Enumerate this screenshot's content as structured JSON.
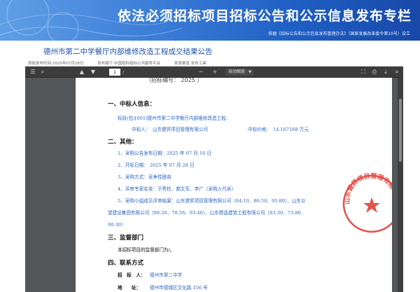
{
  "banner": {
    "title": "依法必须招标项目招标公告和公示信息发布专栏",
    "subtitle": "依据《招标公告和公示信息发布管理办法》（国家发展改革委令第10号）设立"
  },
  "page": {
    "title": "德州市第二中学餐厅内部维修改造工程成交结果公告",
    "meta": [
      "原始发布时间:2025年07月28日",
      "发布媒介:中国招标投标公共服务平台",
      "来源渠道:发布工具"
    ]
  },
  "viewer": {
    "toolbar": {
      "current_page": "1",
      "page_sep": "/",
      "zoom": "自动缩放"
    },
    "top_cut_text": "（招标编号：     2025               ）",
    "sections": {
      "winner_heading": "一、中标人信息：",
      "lot_line": "标段(包)[001]德州市第二中学餐厅内部维修改造工程:",
      "winner_label": "中标人：",
      "winner_name": "山东健昇项目管理有限公司",
      "price_label": "中标价格：",
      "price_value": "14.167168 万元",
      "other_heading": "二、其他：",
      "other_items": [
        "1、采购公告发布日期：2025 年 07 月 16 日",
        "2、开标日期： 2025 年 07 月 28 日",
        "3、采购方式：竞争性磋商",
        "4、评审专家名单：于秀柱、郝文军、李广（采购人代表）",
        "5、采购小组成员评审结果：山东健昇项目管理有限公司（84.10、86.50、95.80）、山东众",
        "望建设集团有限公司（86.26、78.56、93.46）、山东鼎晶建筑工程有限公司（83.30、73.80、",
        "90.30）"
      ],
      "supervise_heading": "三、监督部门",
      "supervise_text": "本招标项目的监督部门为/。",
      "contact_heading": "四、联系方式",
      "buyer_label": "招　标　人：",
      "buyer_value": "德州市第二中学",
      "address_label": "地　　址：",
      "address_value": "德州市德城区文化路 156 号"
    },
    "seal_text": "山东健昇项目管理有限公司"
  }
}
